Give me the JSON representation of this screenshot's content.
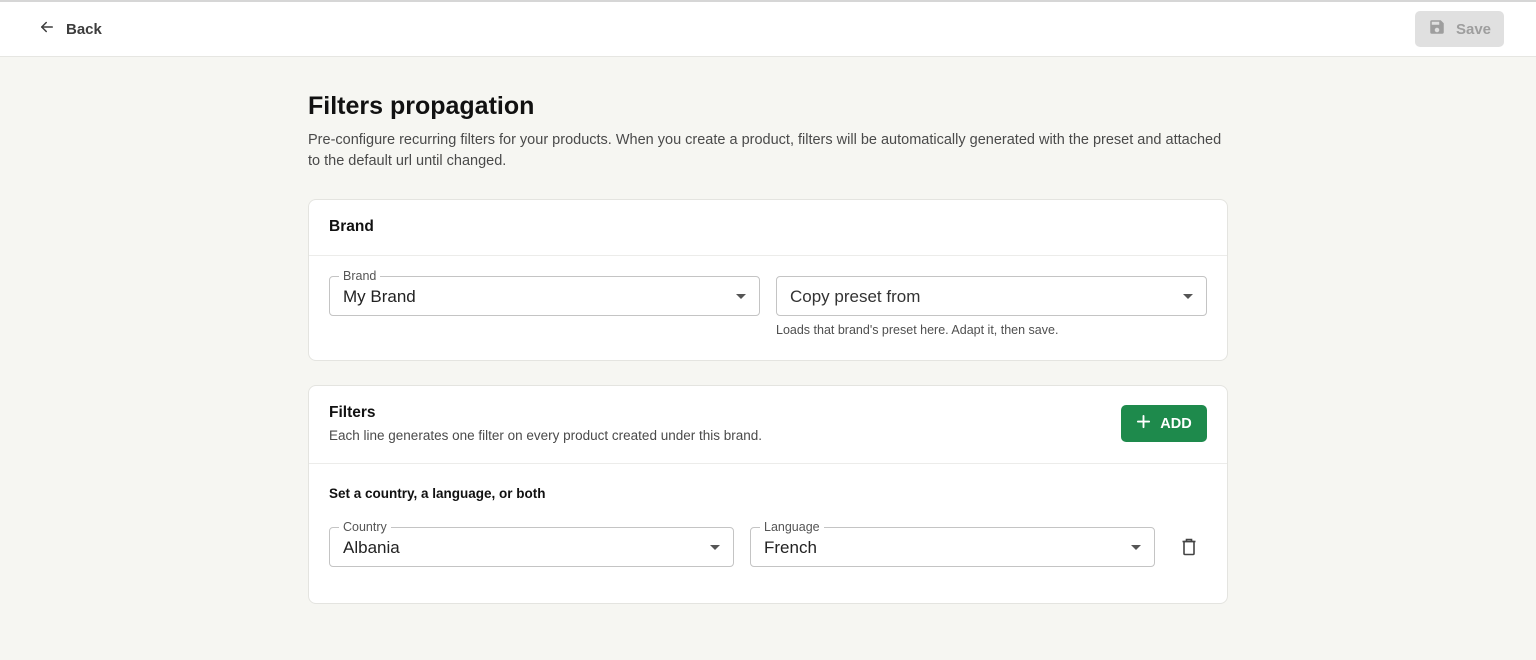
{
  "header": {
    "back_label": "Back",
    "save_label": "Save"
  },
  "page": {
    "title": "Filters propagation",
    "description": "Pre-configure recurring filters for your products. When you create a product, filters will be automatically generated with the preset and attached to the default url until changed."
  },
  "brand_card": {
    "title": "Brand",
    "brand_field": {
      "label": "Brand",
      "value": "My Brand"
    },
    "copy_preset_field": {
      "placeholder": "Copy preset from",
      "helper": "Loads that brand's preset here. Adapt it, then save."
    }
  },
  "filters_card": {
    "title": "Filters",
    "subtitle": "Each line generates one filter on every product created under this brand.",
    "add_label": "ADD",
    "section_label": "Set a country, a language, or both",
    "rows": [
      {
        "country": {
          "label": "Country",
          "value": "Albania"
        },
        "language": {
          "label": "Language",
          "value": "French"
        }
      }
    ]
  },
  "colors": {
    "accent_green": "#1e8a4c",
    "page_bg": "#f6f6f2",
    "disabled_button": "#e0e0e0"
  },
  "icons": [
    "arrow-left-icon",
    "floppy-disk-icon",
    "plus-icon",
    "chevron-down-icon",
    "trash-icon"
  ]
}
